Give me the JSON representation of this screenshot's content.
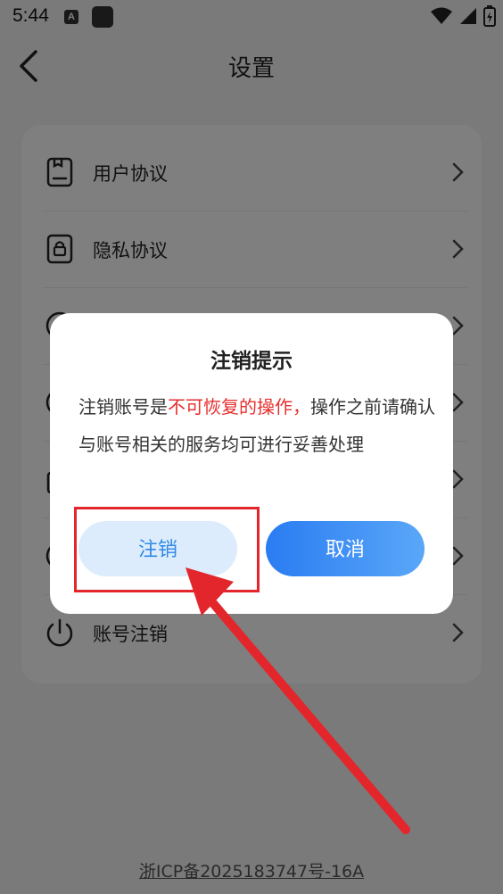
{
  "status_bar": {
    "time": "5:44",
    "icons": [
      "a-notification-icon",
      "square-notification-icon",
      "wifi-icon",
      "signal-icon",
      "battery-charging-icon"
    ]
  },
  "header": {
    "title": "设置",
    "back_icon": "chevron-left-icon"
  },
  "settings": {
    "items": [
      {
        "label": "用户协议",
        "icon": "document-icon"
      },
      {
        "label": "隐私协议",
        "icon": "lock-document-icon"
      },
      {
        "label": "",
        "icon": "circle-icon"
      },
      {
        "label": "",
        "icon": "circle-icon"
      },
      {
        "label": "",
        "icon": "bag-icon"
      },
      {
        "label": "",
        "icon": "circle-icon"
      },
      {
        "label": "账号注销",
        "icon": "power-icon"
      }
    ]
  },
  "footer": {
    "icp": "浙ICP备2025183747号-16A"
  },
  "dialog": {
    "title": "注销提示",
    "body_prefix": "注销账号是",
    "body_warning": "不可恢复的操作，",
    "body_suffix": "操作之前请确认与账号相关的服务均可进行妥善处理",
    "confirm_label": "注销",
    "cancel_label": "取消"
  },
  "colors": {
    "warning": "#e82e2e",
    "primary": "#2a7cf2",
    "highlight": "#e3262b"
  }
}
